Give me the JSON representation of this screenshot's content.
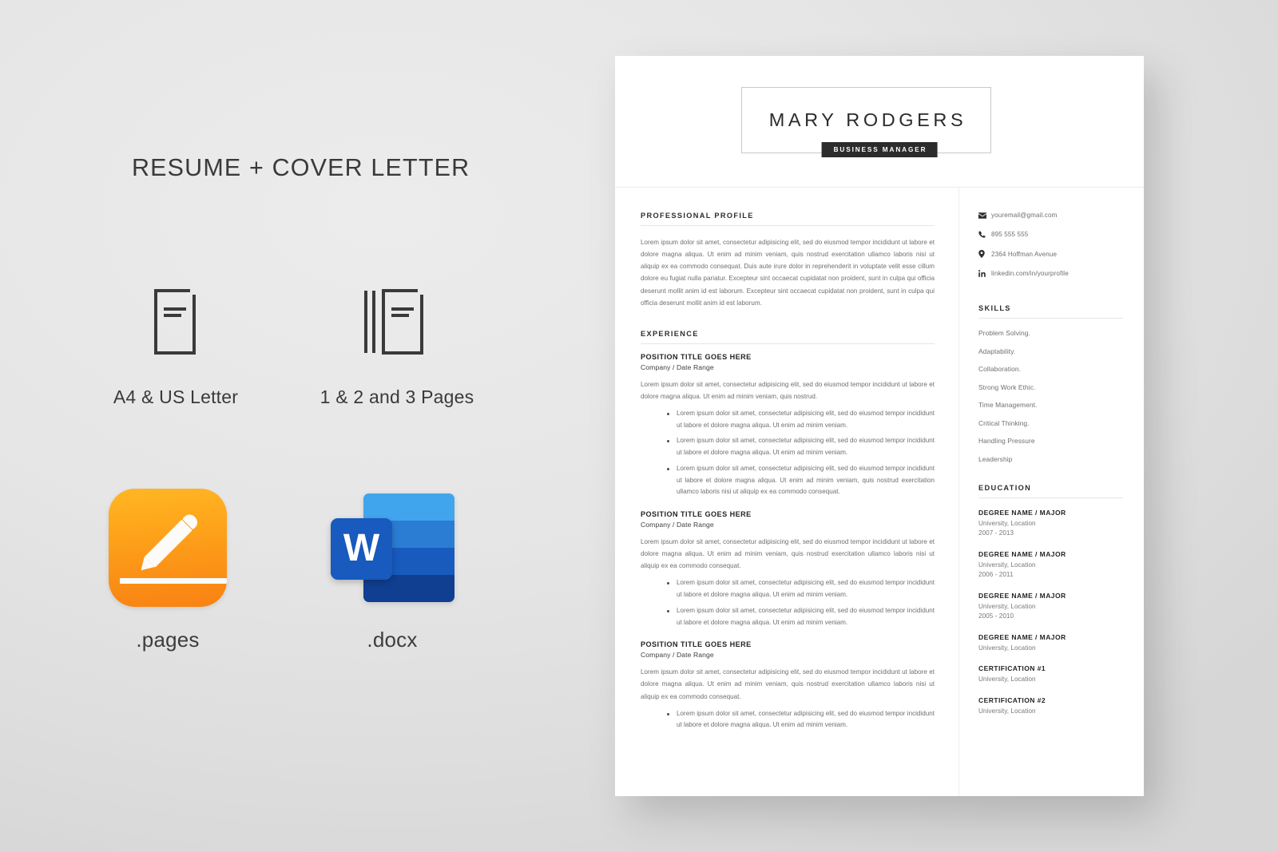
{
  "promo": {
    "title": "RESUME + COVER LETTER",
    "features": [
      {
        "icon": "single-document-icon",
        "caption": "A4 & US Letter"
      },
      {
        "icon": "stacked-documents-icon",
        "caption": "1 & 2 and 3 Pages"
      }
    ],
    "formats": [
      {
        "icon": "pages-app-icon",
        "caption": ".pages"
      },
      {
        "icon": "word-app-icon",
        "letter": "W",
        "caption": ".docx"
      }
    ]
  },
  "resume": {
    "name": "MARY RODGERS",
    "role": "BUSINESS MANAGER",
    "profile": {
      "heading": "PROFESSIONAL PROFILE",
      "text": "Lorem ipsum dolor sit amet, consectetur adipisicing elit, sed do eiusmod tempor incididunt ut labore et dolore magna aliqua. Ut enim ad minim veniam, quis nostrud exercitation ullamco laboris nisi ut aliquip ex ea commodo consequat. Duis aute irure dolor in reprehenderit in voluptate velit esse cillum dolore eu fugiat nulla pariatur. Excepteur sint occaecat cupidatat non proident, sunt in culpa qui officia deserunt mollit anim id est laborum. Excepteur sint occaecat cupidatat non proident, sunt in culpa qui officia deserunt mollit anim id est laborum."
    },
    "experience": {
      "heading": "EXPERIENCE",
      "jobs": [
        {
          "title": "POSITION TITLE GOES HERE",
          "meta": "Company / Date Range",
          "summary": "Lorem ipsum dolor sit amet, consectetur adipisicing elit, sed do eiusmod tempor incididunt ut labore et dolore magna aliqua. Ut enim ad minim veniam, quis nostrud.",
          "bullets": [
            "Lorem ipsum dolor sit amet, consectetur adipisicing elit, sed do eiusmod tempor incididunt ut labore et dolore magna aliqua. Ut enim ad minim veniam.",
            "Lorem ipsum dolor sit amet, consectetur adipisicing elit, sed do eiusmod tempor incididunt ut labore et dolore magna aliqua. Ut enim ad minim veniam.",
            "Lorem ipsum dolor sit amet, consectetur adipisicing elit, sed do eiusmod tempor incididunt ut labore et dolore magna aliqua. Ut enim ad minim veniam, quis nostrud exercitation ullamco laboris nisi ut aliquip ex ea commodo consequat."
          ]
        },
        {
          "title": "POSITION TITLE GOES HERE",
          "meta": "Company / Date Range",
          "summary": "Lorem ipsum dolor sit amet, consectetur adipisicing elit, sed do eiusmod tempor incididunt ut labore et dolore magna aliqua. Ut enim ad minim veniam, quis nostrud exercitation ullamco laboris nisi ut aliquip ex ea commodo consequat.",
          "bullets": [
            "Lorem ipsum dolor sit amet, consectetur adipisicing elit, sed do eiusmod tempor incididunt ut labore et dolore magna aliqua. Ut enim ad minim veniam.",
            "Lorem ipsum dolor sit amet, consectetur adipisicing elit, sed do eiusmod tempor incididunt ut labore et dolore magna aliqua. Ut enim ad minim veniam."
          ]
        },
        {
          "title": "POSITION TITLE GOES HERE",
          "meta": "Company / Date Range",
          "summary": "Lorem ipsum dolor sit amet, consectetur adipisicing elit, sed do eiusmod tempor incididunt ut labore et dolore magna aliqua. Ut enim ad minim veniam, quis nostrud exercitation ullamco laboris nisi ut aliquip ex ea commodo consequat.",
          "bullets": [
            "Lorem ipsum dolor sit amet, consectetur adipisicing elit, sed do eiusmod tempor incididunt ut labore et dolore magna aliqua. Ut enim ad minim veniam."
          ]
        }
      ]
    },
    "contact": [
      {
        "icon": "email-icon",
        "value": "youremail@gmail.com"
      },
      {
        "icon": "phone-icon",
        "value": "895 555 555"
      },
      {
        "icon": "location-pin-icon",
        "value": "2364 Hoffman Avenue"
      },
      {
        "icon": "linkedin-icon",
        "value": "linkedin.com/in/yourprofile"
      }
    ],
    "skills": {
      "heading": "SKILLS",
      "items": [
        "Problem Solving.",
        "Adaptability.",
        "Collaboration.",
        "Strong Work Ethic.",
        "Time Management.",
        "Critical Thinking.",
        "Handling Pressure",
        "Leadership"
      ]
    },
    "education": {
      "heading": "EDUCATION",
      "items": [
        {
          "degree": "DEGREE NAME / MAJOR",
          "school": "University, Location",
          "years": "2007 - 2013"
        },
        {
          "degree": "DEGREE NAME / MAJOR",
          "school": "University, Location",
          "years": "2006 - 2011"
        },
        {
          "degree": "DEGREE NAME / MAJOR",
          "school": "University, Location",
          "years": "2005 - 2010"
        },
        {
          "degree": "DEGREE NAME / MAJOR",
          "school": "University, Location",
          "years": ""
        },
        {
          "degree": "CERTIFICATION #1",
          "school": "University, Location",
          "years": ""
        },
        {
          "degree": "CERTIFICATION #2",
          "school": "University, Location",
          "years": ""
        }
      ]
    }
  },
  "colors": {
    "background": "#e6e6e6",
    "page": "#ffffff",
    "badge": "#2c2c2c",
    "pages_orange": "#fb9116",
    "word_blue": "#185abd",
    "body_text": "#6f6f6f",
    "heading_text": "#2d2d2d"
  }
}
